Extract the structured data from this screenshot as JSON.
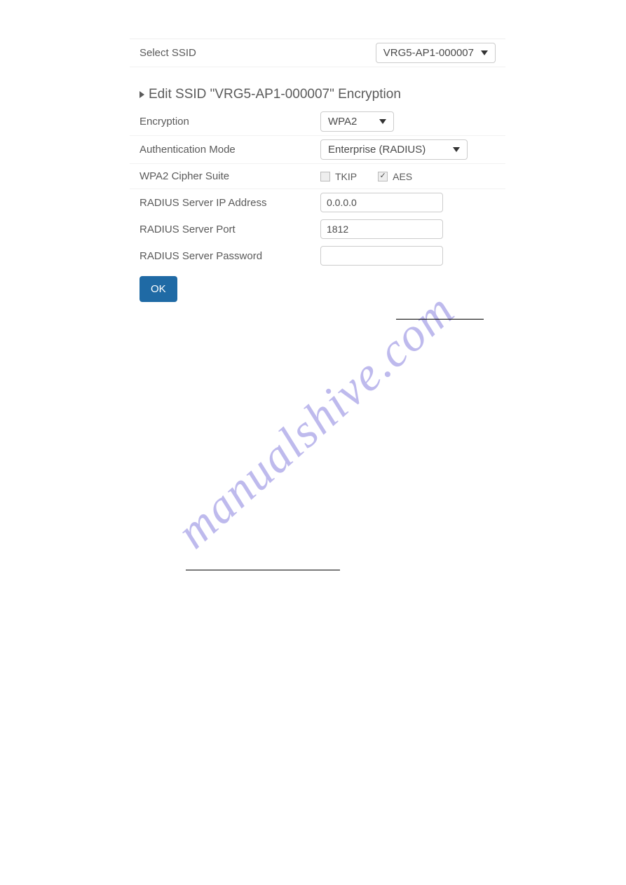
{
  "selectSsidLabel": "Select SSID",
  "selectedSsid": "VRG5-AP1-000007",
  "editTitle": "Edit SSID \"VRG5-AP1-000007\" Encryption",
  "labels": {
    "encryption": "Encryption",
    "authMode": "Authentication Mode",
    "cipherSuite": "WPA2 Cipher Suite",
    "radiusIp": "RADIUS Server IP Address",
    "radiusPort": "RADIUS Server Port",
    "radiusPass": "RADIUS Server Password"
  },
  "values": {
    "encryption": "WPA2",
    "authMode": "Enterprise (RADIUS)",
    "tkipLabel": "TKIP",
    "aesLabel": "AES",
    "radiusIp": "0.0.0.0",
    "radiusPort": "1812",
    "radiusPass": ""
  },
  "okLabel": "OK",
  "watermark": "manualshive.com"
}
